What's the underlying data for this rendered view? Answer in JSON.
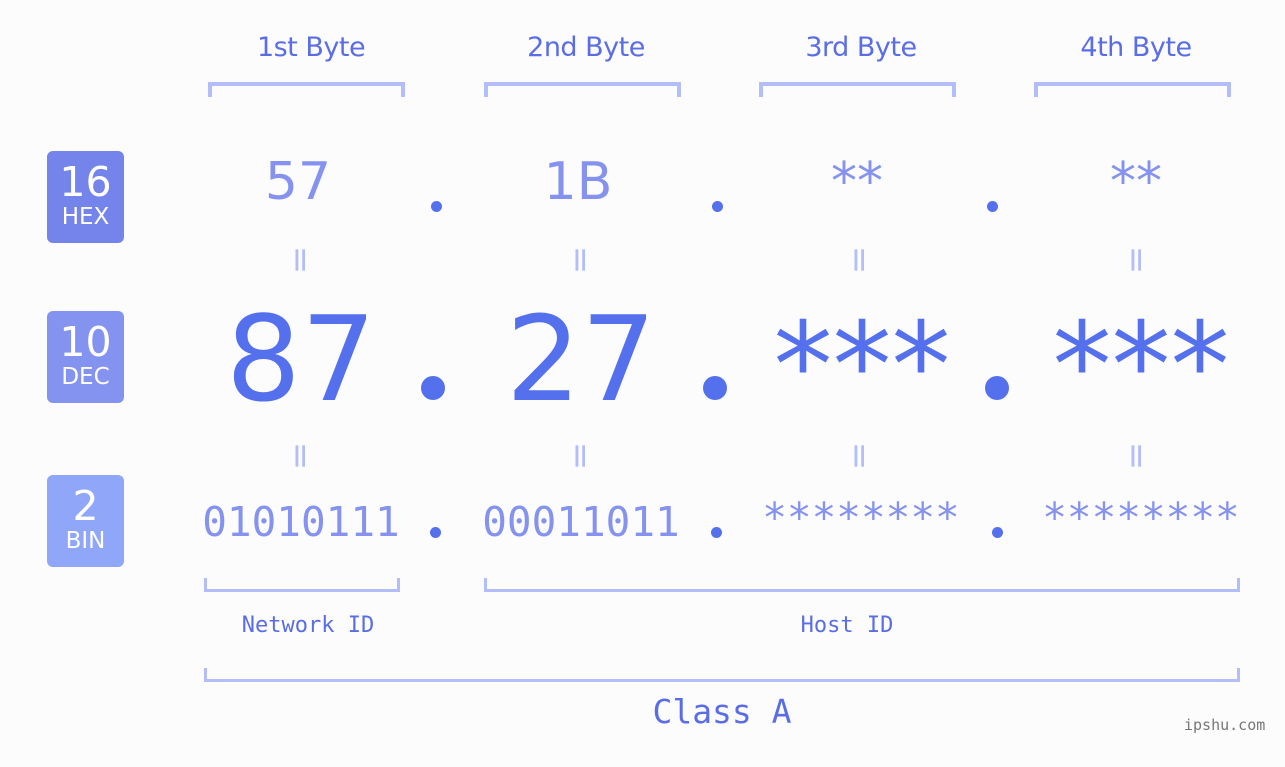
{
  "headers": [
    "1st Byte",
    "2nd Byte",
    "3rd Byte",
    "4th Byte"
  ],
  "badges": [
    {
      "num": "16",
      "label": "HEX",
      "color": "#7584ea"
    },
    {
      "num": "10",
      "label": "DEC",
      "color": "#8593f0"
    },
    {
      "num": "2",
      "label": "BIN",
      "color": "#8fa6f9"
    }
  ],
  "hex": [
    "57",
    "1B",
    "**",
    "**"
  ],
  "dec": [
    "87",
    "27",
    "***",
    "***"
  ],
  "bin": [
    "01010111",
    "00011011",
    "********",
    "********"
  ],
  "equals": "=",
  "network_label": "Network ID",
  "host_label": "Host ID",
  "class_label": "Class A",
  "watermark": "ipshu.com",
  "colors": {
    "accent": "#5570ec",
    "light": "#8592ef",
    "bracket": "#b3bdf7",
    "background": "#fbfcfb"
  }
}
